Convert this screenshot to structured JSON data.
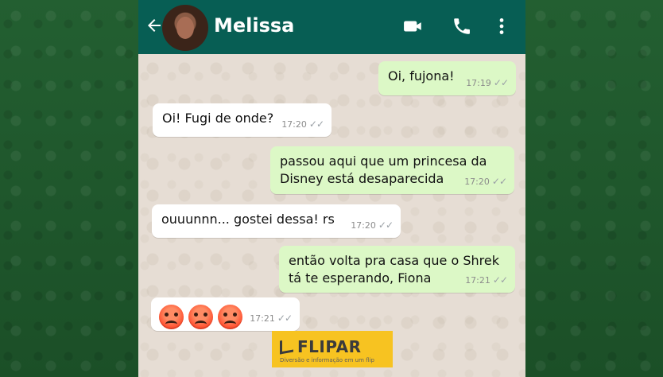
{
  "contact": {
    "name": "Melissa"
  },
  "messages": [
    {
      "side": "sent",
      "text": "Oi, fujona!",
      "time": "17:19"
    },
    {
      "side": "received",
      "text": "Oi! Fugi de onde?",
      "time": "17:20"
    },
    {
      "side": "sent",
      "text": "passou aqui que um princesa da\nDisney está desaparecida",
      "time": "17:20"
    },
    {
      "side": "received",
      "text": "ouuunnn... gostei dessa! rs",
      "time": "17:20"
    },
    {
      "side": "sent",
      "text": "então volta pra casa que o Shrek\ntá te esperando, Fiona",
      "time": "17:21"
    },
    {
      "side": "received",
      "text": "",
      "time": "17:21",
      "emojis": [
        "angry-face-emoji",
        "angry-face-emoji",
        "angry-face-emoji"
      ]
    }
  ],
  "icons": {
    "back": "back-arrow-icon",
    "video": "video-call-icon",
    "call": "voice-call-icon",
    "more": "more-options-icon",
    "ticks": "double-check-icon"
  },
  "brand": {
    "logo_text": "FLIPAR",
    "tagline": "Diversão e informação em um flip",
    "color": "#f7c321"
  },
  "colors": {
    "header": "#075e54",
    "sent_bubble": "#dcf8c6",
    "received_bubble": "#ffffff",
    "background": "#1f5a2c"
  }
}
